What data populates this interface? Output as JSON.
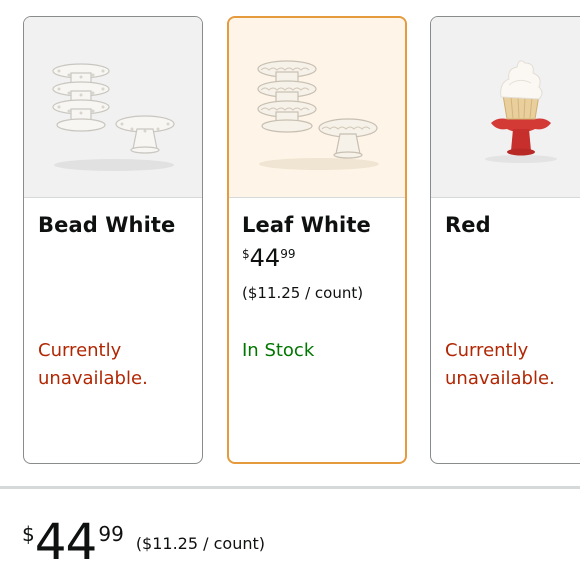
{
  "swatches": [
    {
      "name": "Bead White",
      "availability": "Currently unavailable.",
      "image_icon": "bead-white-cake-stands-icon"
    },
    {
      "name": "Leaf White",
      "price_symbol": "$",
      "price_whole": "44",
      "price_fraction": "99",
      "unit_price": "($11.25 / count)",
      "availability": "In Stock",
      "selected": true,
      "image_icon": "leaf-white-cake-stands-icon"
    },
    {
      "name": "Red",
      "availability": "Currently unavailable.",
      "image_icon": "red-cake-stand-cupcake-icon"
    }
  ],
  "summary": {
    "price_symbol": "$",
    "price_whole": "44",
    "price_fraction": "99",
    "unit_price": "($11.25 / count)"
  },
  "colors": {
    "selected_border": "#e59a3b",
    "selected_background": "#fef4e7",
    "unavailable_text": "#b12704",
    "in_stock_text": "#007600"
  }
}
